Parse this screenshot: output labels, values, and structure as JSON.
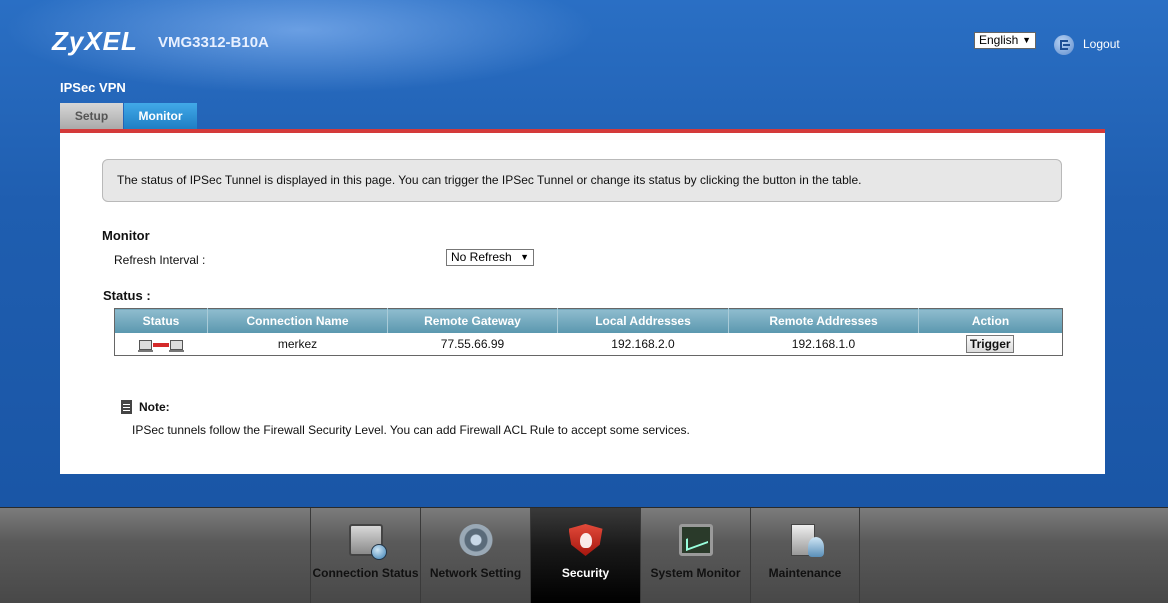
{
  "header": {
    "brand": "ZyXEL",
    "model": "VMG3312-B10A",
    "language": "English",
    "logout": "Logout"
  },
  "page": {
    "title": "IPSec VPN",
    "tabs": [
      {
        "label": "Setup",
        "active": false
      },
      {
        "label": "Monitor",
        "active": true
      }
    ],
    "info_text": "The status of IPSec Tunnel is displayed in this page. You can trigger the IPSec Tunnel or change its status by clicking the button in the table."
  },
  "monitor": {
    "heading": "Monitor",
    "refresh_label": "Refresh Interval :",
    "refresh_value": "No Refresh"
  },
  "status": {
    "heading": "Status :",
    "columns": [
      "Status",
      "Connection Name",
      "Remote Gateway",
      "Local Addresses",
      "Remote Addresses",
      "Action"
    ],
    "rows": [
      {
        "status_icon": "tunnel-connected-icon",
        "connection_name": "merkez",
        "remote_gateway": "77.55.66.99",
        "local_addresses": "192.168.2.0",
        "remote_addresses": "192.168.1.0",
        "action": "Trigger"
      }
    ]
  },
  "note": {
    "title": "Note:",
    "text": "IPSec tunnels follow the Firewall Security Level. You can add Firewall ACL Rule to accept some services."
  },
  "bottom_nav": [
    {
      "label": "Connection Status",
      "icon": "connection-status-icon",
      "active": false
    },
    {
      "label": "Network Setting",
      "icon": "network-setting-icon",
      "active": false
    },
    {
      "label": "Security",
      "icon": "security-icon",
      "active": true
    },
    {
      "label": "System Monitor",
      "icon": "system-monitor-icon",
      "active": false
    },
    {
      "label": "Maintenance",
      "icon": "maintenance-icon",
      "active": false
    }
  ],
  "colors": {
    "background_blue": "#1f5aa8",
    "tab_underline": "#d43a3a",
    "table_header": "#6fa5ba",
    "active_tab": "#2a8fd6"
  }
}
